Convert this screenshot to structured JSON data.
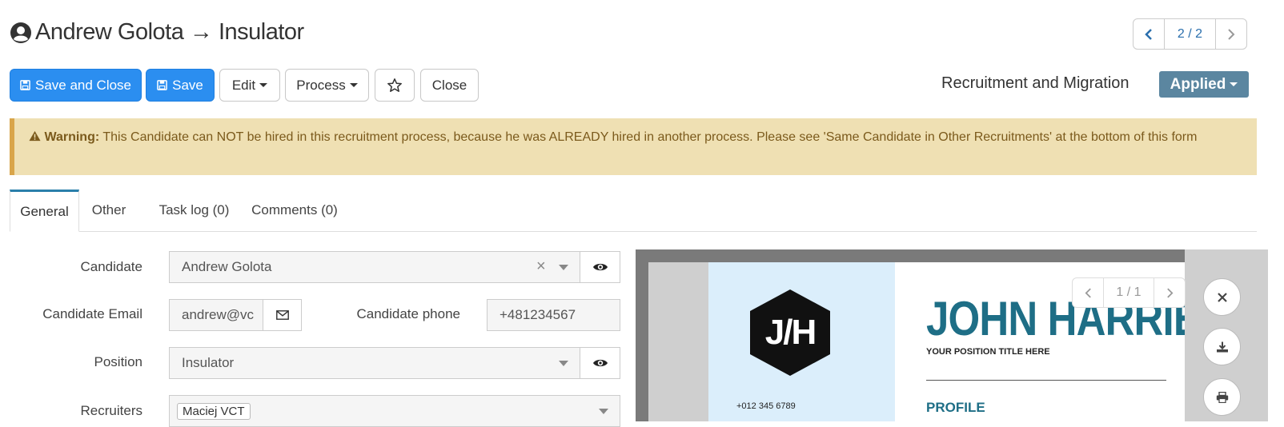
{
  "header": {
    "title": "Andrew Golota → Insulator",
    "user_icon": "user-circle-icon",
    "pager": {
      "text": "2 / 2"
    }
  },
  "toolbar": {
    "save_close_label": "Save and Close",
    "save_label": "Save",
    "edit_label": "Edit",
    "process_label": "Process",
    "close_label": "Close",
    "process_name": "Recruitment and Migration",
    "status_label": "Applied"
  },
  "warning": {
    "prefix": "Warning:",
    "text": "This Candidate can NOT be hired in this recruitment process, because he was ALREADY hired in another process. Please see 'Same Candidate in Other Recruitments' at the bottom of this form"
  },
  "tabs": [
    {
      "label": "General"
    },
    {
      "label": "Other"
    },
    {
      "label": "Task log (0)"
    },
    {
      "label": "Comments (0)"
    }
  ],
  "form": {
    "candidate_label": "Candidate",
    "candidate_value": "Andrew Golota",
    "email_label": "Candidate Email",
    "email_value": "andrew@vc",
    "phone_label": "Candidate phone",
    "phone_value": "+481234567",
    "position_label": "Position",
    "position_value": "Insulator",
    "recruiters_label": "Recruiters",
    "recruiters_tag": "Maciej VCT"
  },
  "preview": {
    "pager": "1 / 1",
    "monogram": "J/H",
    "phone": "+012 345 6789",
    "name": "JOHN HARRIE",
    "position": "YOUR POSITION TITLE HERE",
    "section": "PROFILE"
  },
  "colors": {
    "primary": "#2b8ef0",
    "status": "#5b86a0",
    "warning_bg": "#efe0b3",
    "warning_text": "#7b5a1c",
    "cv_accent": "#1e6e86"
  }
}
